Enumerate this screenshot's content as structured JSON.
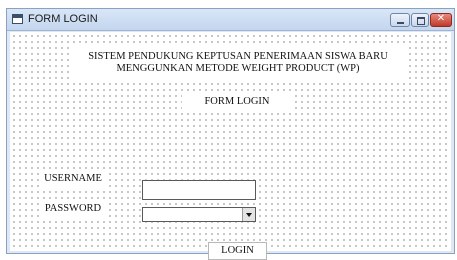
{
  "window": {
    "title": "FORM LOGIN",
    "icon": "form-window-icon",
    "controls": [
      "minimize-icon",
      "maximize-icon",
      "close-icon"
    ],
    "close_color": "#c0392b"
  },
  "header": {
    "line1": "SISTEM PENDUKUNG KEPTUSAN PENERIMAAN SISWA BARU",
    "line2": "MENGGUNKAN METODE WEIGHT PRODUCT (WP)"
  },
  "form": {
    "title": "FORM LOGIN",
    "username_label": "USERNAME",
    "username_value": "",
    "password_label": "PASSWORD",
    "password_value": "",
    "login_label": "LOGIN"
  }
}
